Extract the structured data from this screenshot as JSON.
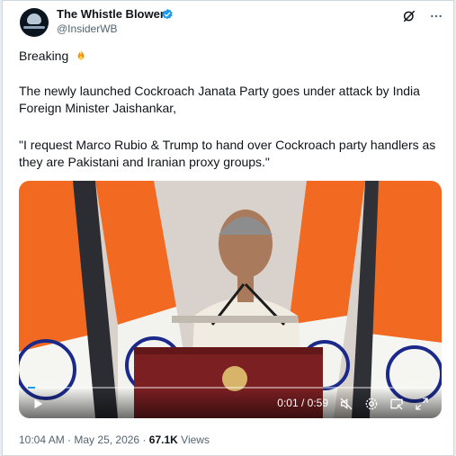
{
  "author": {
    "name": "The Whistle Blower",
    "handle": "@InsiderWB",
    "verified_color": "#1d9bf0"
  },
  "top_icons": [
    "grok-icon",
    "more-icon"
  ],
  "tweet": {
    "line1": "Breaking",
    "line2": "The newly launched Cockroach Janata Party goes under attack by India Foreign Minister Jaishankar,",
    "line3": "\"I request Marco Rubio & Trump to hand over Cockroach party handlers as they are Pakistani and Iranian proxy groups.\""
  },
  "video": {
    "time": "0:01 / 0:59",
    "progress_fraction": 0.017,
    "controls": [
      "play-icon",
      "mute-icon",
      "settings-icon",
      "pip-icon",
      "fullscreen-icon"
    ]
  },
  "meta": {
    "time": "10:04 AM",
    "sep": "·",
    "date": "May 25, 2026",
    "views_count": "67.1K",
    "views_label": "Views"
  }
}
